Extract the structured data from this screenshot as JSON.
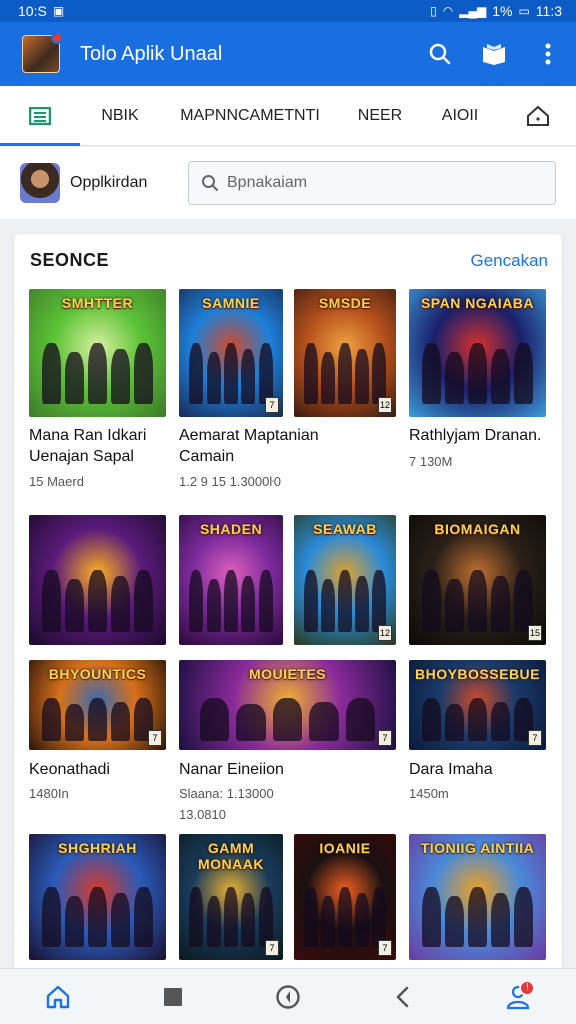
{
  "status_bar": {
    "time": "10:S",
    "battery": "1%",
    "clock_right": "11:3"
  },
  "app_bar": {
    "title": "Tolo Aplik Unaal"
  },
  "tabs": [
    {
      "label": "",
      "icon": "list-icon",
      "active": true
    },
    {
      "label": "NBIK"
    },
    {
      "label": "MAPNNCAMETNTI"
    },
    {
      "label": "NEER"
    },
    {
      "label": "AIOII"
    },
    {
      "label": "",
      "icon": "home-outline-icon"
    }
  ],
  "profile": {
    "label": "Opplkirdan"
  },
  "search": {
    "placeholder": "Bpnakaiam"
  },
  "section": {
    "title": "SEONCE",
    "link": "Gencakan"
  },
  "games": [
    {
      "name": "Mana Ran Idkari Uenajan Sapal",
      "meta": "15 Maerd",
      "art_title": "SMHTTER",
      "colors": [
        "#5bc236",
        "#d9f0a0",
        "#3d7a2a"
      ],
      "rating": ""
    },
    {
      "name": "Aemarat Maptanian Camain",
      "meta": "1.2 9 15 1.3000ŀ0",
      "art_title": "SAMNIE",
      "colors": [
        "#1c7fd8",
        "#d14a2a",
        "#1a2a55"
      ],
      "rating": "7"
    },
    {
      "name": "",
      "meta": "",
      "art_title": "SMSDE",
      "colors": [
        "#b5501c",
        "#f0a040",
        "#3a1a10"
      ],
      "rating": "12"
    },
    {
      "name": "Rathlyjam Dranan.",
      "meta": "7 130M",
      "art_title": "SPAN NGAIABA",
      "colors": [
        "#1a1f6a",
        "#d8302a",
        "#3d9bd8"
      ],
      "rating": ""
    },
    {
      "name": "",
      "meta": "",
      "art_title": "",
      "colors": [
        "#5a1a7a",
        "#ffb020",
        "#1a0a2a"
      ],
      "rating": ""
    },
    {
      "name": "",
      "meta": "",
      "art_title": "SHADEN",
      "colors": [
        "#7a2a9a",
        "#e060c0",
        "#2a0a3a"
      ],
      "rating": ""
    },
    {
      "name": "",
      "meta": "",
      "art_title": "SEAWAB",
      "colors": [
        "#2a8ad8",
        "#e0a030",
        "#2a3a1a"
      ],
      "rating": "12"
    },
    {
      "name": "",
      "meta": "",
      "art_title": "BIOMAIGAN",
      "colors": [
        "#2a2018",
        "#c07030",
        "#0a0a08"
      ],
      "rating": "15"
    },
    {
      "name": "Keonathadi",
      "meta": "1480In",
      "art_title": "BHYOUNTICS",
      "colors": [
        "#d8701a",
        "#3a6ab0",
        "#2a1408"
      ],
      "rating": "7"
    },
    {
      "name": "Nanar Eineiion",
      "meta": "Slaana: 1.13000 13.0810",
      "art_title": "MOUIETES",
      "colors": [
        "#8a2a9a",
        "#f0b030",
        "#1a1040"
      ],
      "rating": "7"
    },
    {
      "name": "Dara Imaha",
      "meta": "1450m",
      "art_title": "BHOYBOSSEBUE",
      "colors": [
        "#1a3a6a",
        "#d04a2a",
        "#0a1a3a"
      ],
      "rating": "7"
    },
    {
      "name": "",
      "meta": "",
      "art_title": "SHGHRIAH",
      "colors": [
        "#2a5ab8",
        "#d83a2a",
        "#1a1030"
      ],
      "rating": ""
    },
    {
      "name": "",
      "meta": "",
      "art_title": "GAMM MONAAK",
      "colors": [
        "#1a3a5a",
        "#e8b030",
        "#0a1a20"
      ],
      "rating": "7"
    },
    {
      "name": "",
      "meta": "",
      "art_title": "IOANIE",
      "colors": [
        "#1a1010",
        "#f06020",
        "#3a0a0a"
      ],
      "rating": "7"
    },
    {
      "name": "",
      "meta": "",
      "art_title": "TIONIIG AINTIIA",
      "colors": [
        "#4a8ad8",
        "#f0a020",
        "#6a3aa0"
      ],
      "rating": ""
    }
  ]
}
